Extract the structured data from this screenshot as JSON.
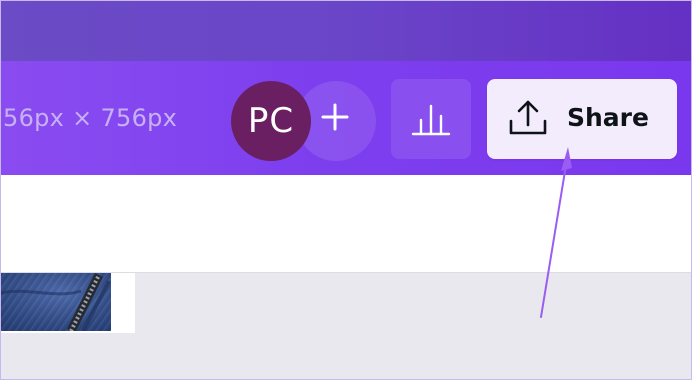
{
  "colors": {
    "top_strip": "#6b4bc6",
    "toolbar": "#7d3fee",
    "avatar_bg": "#6a1f62",
    "share_bg": "#f3ecfc",
    "share_text": "#0e1318",
    "dimensions_text": "#c6b1f5",
    "annotation_arrow": "#9a5cf2",
    "canvas_bg": "#e8e8ee"
  },
  "toolbar": {
    "dimensions": "56px × 756px",
    "avatar_initials": "PC",
    "add_collaborator_icon": "plus-icon",
    "insights_icon": "bar-chart-icon",
    "share": {
      "label": "Share",
      "icon": "upload-icon"
    }
  },
  "canvas": {
    "thumbnail_icon": "denim-fabric-image"
  },
  "annotation": {
    "icon": "pointer-arrow",
    "target": "share-button"
  }
}
